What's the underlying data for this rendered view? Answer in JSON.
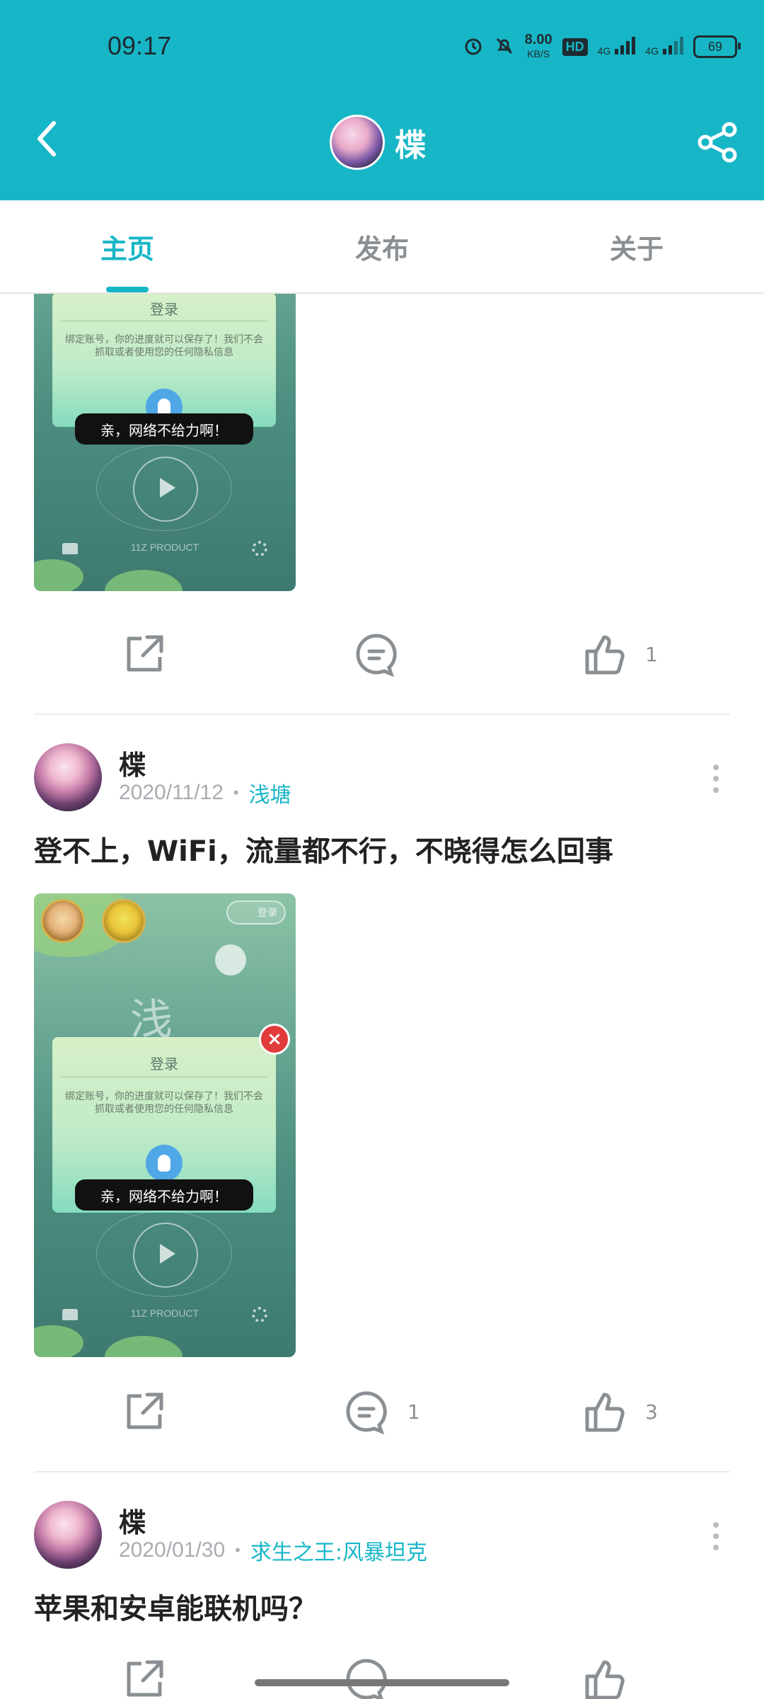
{
  "status": {
    "time": "09:17",
    "speed_value": "8.00",
    "speed_unit": "KB/S",
    "hd_label": "HD",
    "net1": "4G",
    "net2": "4G",
    "battery": "69"
  },
  "header": {
    "title": "楪"
  },
  "tabs": [
    {
      "label": "主页",
      "active": true
    },
    {
      "label": "发布",
      "active": false
    },
    {
      "label": "关于",
      "active": false
    }
  ],
  "posts": [
    {
      "shot": {
        "dialog_title": "登录",
        "dialog_text": "绑定账号，你的进度就可以保存了！我们不会抓取或者使用您的任何隐私信息",
        "toast": "亲，网络不给力啊！",
        "product": "11Z PRODUCT"
      },
      "comments": "",
      "likes": "1"
    },
    {
      "author": "楪",
      "date": "2020/11/12",
      "separator": "•",
      "tag": "浅塘",
      "text": "登不上，WiFi，流量都不行，不晓得怎么回事",
      "shot": {
        "login_pill": "登录",
        "big_char": "浅",
        "dialog_title": "登录",
        "dialog_text": "绑定账号，你的进度就可以保存了！我们不会抓取或者使用您的任何隐私信息",
        "toast": "亲，网络不给力啊！",
        "product": "11Z PRODUCT"
      },
      "comments": "1",
      "likes": "3"
    },
    {
      "author": "楪",
      "date": "2020/01/30",
      "separator": "•",
      "tag": "求生之王:风暴坦克",
      "text": "苹果和安卓能联机吗？"
    }
  ],
  "colors": {
    "accent": "#17b6c6",
    "header_bg": "#17b6c6"
  },
  "icons": [
    "back-arrow-icon",
    "share-icon",
    "external-share-icon",
    "comment-icon",
    "thumbs-up-icon",
    "more-vertical-icon"
  ]
}
